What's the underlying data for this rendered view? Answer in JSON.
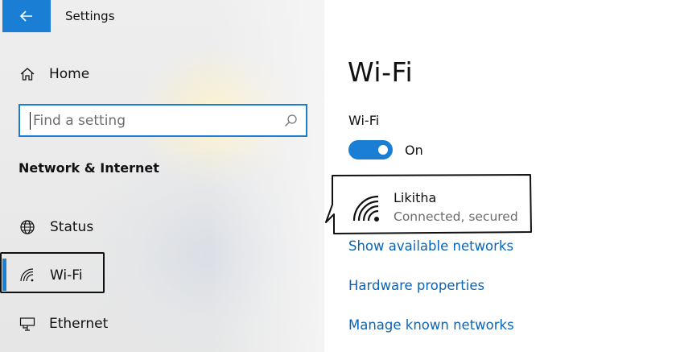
{
  "app": {
    "title": "Settings"
  },
  "sidebar": {
    "home_label": "Home",
    "search": {
      "placeholder": "Find a setting",
      "value": ""
    },
    "section_header": "Network & Internet",
    "items": [
      {
        "label": "Status",
        "icon": "globe-icon"
      },
      {
        "label": "Wi-Fi",
        "icon": "wifi-icon",
        "selected": true
      },
      {
        "label": "Ethernet",
        "icon": "ethernet-icon"
      }
    ]
  },
  "main": {
    "title": "Wi-Fi",
    "wifi_label": "Wi-Fi",
    "toggle_state": "On",
    "network": {
      "name": "Likitha",
      "status": "Connected, secured"
    },
    "links": [
      "Show available networks",
      "Hardware properties",
      "Manage known networks"
    ]
  },
  "colors": {
    "accent": "#1a7fd4",
    "link": "#0a64b8",
    "secondary_text": "#6b6b6b"
  }
}
